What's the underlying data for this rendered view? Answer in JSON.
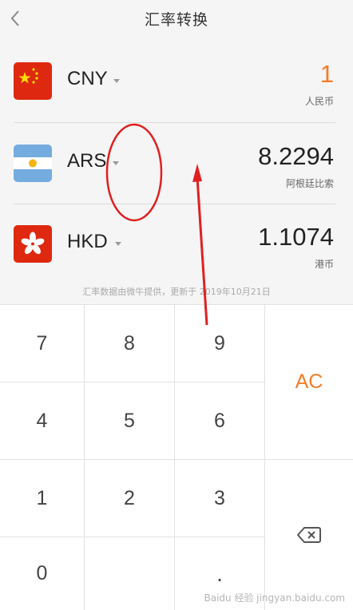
{
  "header": {
    "title": "汇率转换"
  },
  "currencies": [
    {
      "code": "CNY",
      "value": "1",
      "name": "人民币",
      "value_color": "#f57c28",
      "flag": "china-flag-icon"
    },
    {
      "code": "ARS",
      "value": "8.2294",
      "name": "阿根廷比索",
      "value_color": "#222222",
      "flag": "argentina-flag-icon"
    },
    {
      "code": "HKD",
      "value": "1.1074",
      "name": "港币",
      "value_color": "#222222",
      "flag": "hongkong-flag-icon"
    }
  ],
  "note": "汇率数据由微牛提供，更新于 2019年10月21日",
  "keypad": {
    "k7": "7",
    "k8": "8",
    "k9": "9",
    "k4": "4",
    "k5": "5",
    "k6": "6",
    "k1": "1",
    "k2": "2",
    "k3": "3",
    "k0": "0",
    "kdot": ".",
    "ac": "AC",
    "ac_color": "#f57c28",
    "backspace": "backspace-icon"
  },
  "watermark": "Baidu 经验 jingyan.baidu.com"
}
